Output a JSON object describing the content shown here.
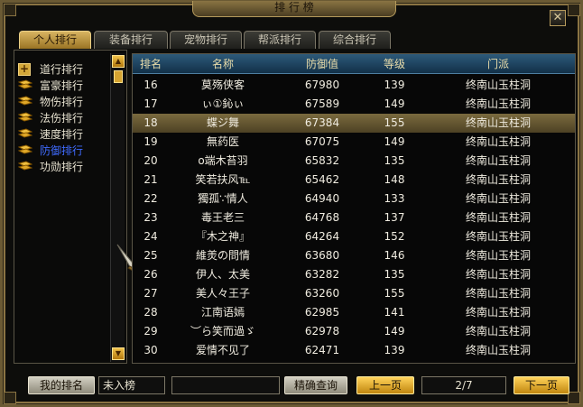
{
  "window": {
    "title": "排 行 榜",
    "close_glyph": "✕"
  },
  "tabs": [
    {
      "label": "个人排行",
      "active": true
    },
    {
      "label": "装备排行",
      "active": false
    },
    {
      "label": "宠物排行",
      "active": false
    },
    {
      "label": "帮派排行",
      "active": false
    },
    {
      "label": "综合排行",
      "active": false
    }
  ],
  "tree": {
    "items": [
      {
        "label": "道行排行",
        "icon": "plus-box-icon",
        "selected": false
      },
      {
        "label": "富豪排行",
        "icon": "scroll-icon",
        "selected": false
      },
      {
        "label": "物伤排行",
        "icon": "scroll-icon",
        "selected": false
      },
      {
        "label": "法伤排行",
        "icon": "scroll-icon",
        "selected": false
      },
      {
        "label": "速度排行",
        "icon": "scroll-icon",
        "selected": false
      },
      {
        "label": "防御排行",
        "icon": "scroll-icon",
        "selected": true
      },
      {
        "label": "功勋排行",
        "icon": "scroll-icon",
        "selected": false
      }
    ]
  },
  "table": {
    "headers": [
      "排名",
      "名称",
      "防御值",
      "等级",
      "门派"
    ],
    "selected_rank": "18",
    "rows": [
      [
        "16",
        "莫殇侠客",
        "67980",
        "139",
        "终南山玉柱洞"
      ],
      [
        "17",
        "ぃ①鈊ぃ",
        "67589",
        "149",
        "终南山玉柱洞"
      ],
      [
        "18",
        "蝶ジ舞",
        "67384",
        "155",
        "终南山玉柱洞"
      ],
      [
        "19",
        "無药医",
        "67075",
        "149",
        "终南山玉柱洞"
      ],
      [
        "20",
        "o端木苔羽",
        "65832",
        "135",
        "终南山玉柱洞"
      ],
      [
        "21",
        "笑若扶风℡",
        "65462",
        "148",
        "终南山玉柱洞"
      ],
      [
        "22",
        "獨孤∵情人",
        "64940",
        "133",
        "终南山玉柱洞"
      ],
      [
        "23",
        "毒王老三",
        "64768",
        "137",
        "终南山玉柱洞"
      ],
      [
        "24",
        "『木之神』",
        "64264",
        "152",
        "终南山玉柱洞"
      ],
      [
        "25",
        "維羙の問情",
        "63680",
        "146",
        "终南山玉柱洞"
      ],
      [
        "26",
        "伊人、太美",
        "63282",
        "135",
        "终南山玉柱洞"
      ],
      [
        "27",
        "美人々王子",
        "63260",
        "155",
        "终南山玉柱洞"
      ],
      [
        "28",
        "江南语嫣",
        "62985",
        "141",
        "终南山玉柱洞"
      ],
      [
        "29",
        "︶ら笑而過ゞ",
        "62978",
        "149",
        "终南山玉柱洞"
      ],
      [
        "30",
        "爱情不见了",
        "62471",
        "139",
        "终南山玉柱洞"
      ]
    ]
  },
  "bottom": {
    "my_rank_label": "我的排名",
    "my_rank_value": "未入榜",
    "search_value": "",
    "search_button": "精确查询",
    "prev_button": "上一页",
    "page": "2/7",
    "next_button": "下一页"
  },
  "colors": {
    "accent_gold": "#d8b461",
    "selected_row": "#6b5c34",
    "header_blue": "#1e4563",
    "selected_tree_text": "#3f6bff"
  }
}
